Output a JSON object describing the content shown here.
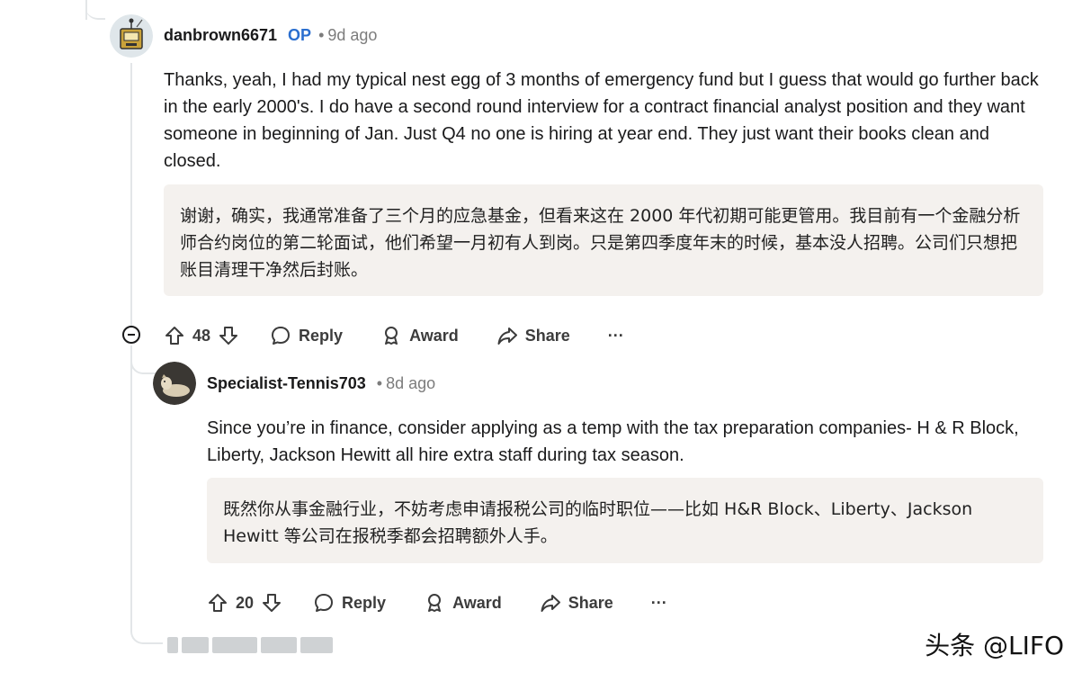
{
  "comments": [
    {
      "author": "danbrown6671",
      "op_badge": "OP",
      "time_sep": "•",
      "time": "9d ago",
      "body": "Thanks, yeah, I had my typical nest egg of 3 months of emergency fund but I guess that would go further back in the early 2000's. I do have a second round interview for a contract financial analyst position and they want someone in beginning of Jan. Just Q4 no one is hiring at year end. They just want their books clean and closed.",
      "translation": "谢谢，确实，我通常准备了三个月的应急基金，但看来这在 2000 年代初期可能更管用。我目前有一个金融分析师合约岗位的第二轮面试，他们希望一月初有人到岗。只是第四季度年末的时候，基本没人招聘。公司们只想把账目清理干净然后封账。",
      "score": "48",
      "reply_label": "Reply",
      "award_label": "Award",
      "share_label": "Share",
      "more_label": "···"
    },
    {
      "author": "Specialist-Tennis703",
      "time_sep": "•",
      "time": "8d ago",
      "body": "Since you’re in finance, consider applying as a temp with the tax preparation companies- H & R Block, Liberty, Jackson Hewitt all hire extra staff during tax season.",
      "translation": "既然你从事金融行业，不妨考虑申请报税公司的临时职位——比如 H&R Block、Liberty、Jackson Hewitt 等公司在报税季都会招聘额外人手。",
      "score": "20",
      "reply_label": "Reply",
      "award_label": "Award",
      "share_label": "Share",
      "more_label": "···"
    }
  ],
  "watermark": "头条 @LIFO",
  "colors": {
    "op_badge": "#2b6fcf",
    "translation_bg": "#f4f1ee",
    "thread_line": "#e3e6e8"
  },
  "icons": [
    "collapse-icon",
    "upvote-icon",
    "downvote-icon",
    "reply-bubble-icon",
    "award-icon",
    "share-arrow-icon",
    "more-icon"
  ]
}
